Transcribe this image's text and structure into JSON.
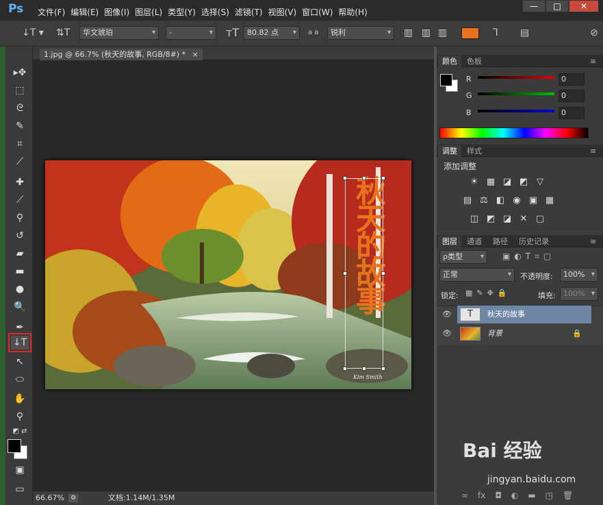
{
  "app": {
    "logo": "Ps"
  },
  "menu": [
    "文件(F)",
    "编辑(E)",
    "图像(I)",
    "图层(L)",
    "类型(Y)",
    "选择(S)",
    "滤镜(T)",
    "视图(V)",
    "窗口(W)",
    "帮助(H)"
  ],
  "window_buttons": {
    "minimize": "—",
    "maximize": "□",
    "close": "✕"
  },
  "options": {
    "font_family": "华文琥珀",
    "font_style": "-",
    "font_size": "80.82 点",
    "antialias_symbol": "a a",
    "antialias": "锐利",
    "text_color": "#e8731e"
  },
  "document": {
    "tab_title": "1.jpg @ 66.7% (秋天的故事, RGB/8#) *",
    "close": "×",
    "canvas_text": "秋天的故事",
    "signature": "Kim Smith"
  },
  "status": {
    "zoom": "66.67%",
    "doc_size": "文档:1.14M/1.35M"
  },
  "color_panel": {
    "tabs": [
      "颜色",
      "色板"
    ],
    "channels": [
      {
        "label": "R",
        "value": "0",
        "color": "#e00000"
      },
      {
        "label": "G",
        "value": "0",
        "color": "#00c000"
      },
      {
        "label": "B",
        "value": "0",
        "color": "#0000e0"
      }
    ]
  },
  "adjust_panel": {
    "tabs": [
      "调整",
      "样式"
    ],
    "title": "添加调整",
    "row1": [
      "☀",
      "▦",
      "◪",
      "◩",
      "▽"
    ],
    "row2": [
      "▤",
      "⚖",
      "◧",
      "◉",
      "▣",
      "▦"
    ],
    "row3": [
      "◫",
      "◩",
      "◪",
      "✕",
      "▢"
    ]
  },
  "layers_panel": {
    "tabs": [
      "图层",
      "通道",
      "路径",
      "历史记录"
    ],
    "filter": "ρ类型",
    "blend_mode": "正常",
    "opacity_label": "不透明度:",
    "opacity": "100%",
    "lock_label": "锁定:",
    "fill_label": "填充:",
    "fill": "100%",
    "layers": [
      {
        "name": "秋天的故事",
        "type": "T",
        "selected": true
      },
      {
        "name": "背景",
        "locked": true,
        "selected": false
      }
    ]
  },
  "watermark": {
    "brand": "Bai 经验",
    "url": "jingyan.baidu.com"
  }
}
